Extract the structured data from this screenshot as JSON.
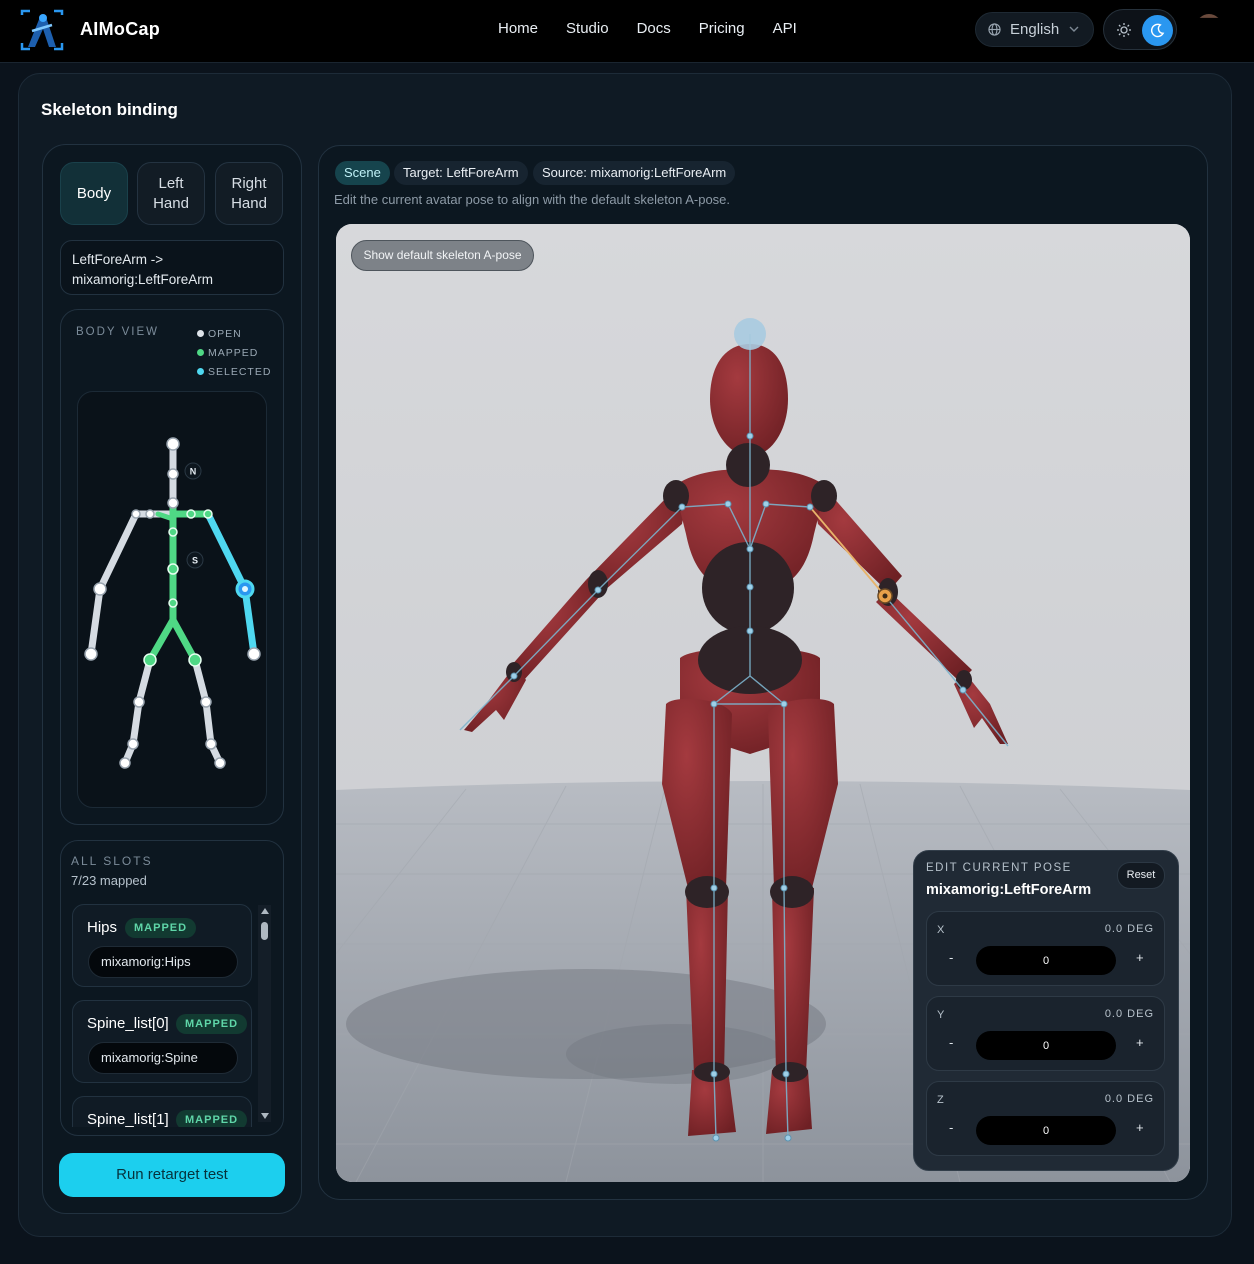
{
  "nav": {
    "brand": "AIMoCap",
    "links": [
      "Home",
      "Studio",
      "Docs",
      "Pricing",
      "API"
    ],
    "language": "English"
  },
  "page": {
    "title": "Skeleton binding"
  },
  "segments": [
    {
      "label": "Body",
      "active": true
    },
    {
      "label": "Left Hand",
      "active": false
    },
    {
      "label": "Right Hand",
      "active": false
    }
  ],
  "mapping": {
    "text": "LeftForeArm -> mixamorig:LeftForeArm"
  },
  "body_view": {
    "title": "BODY VIEW",
    "legend": [
      {
        "label": "OPEN",
        "color": "#dfe4ea"
      },
      {
        "label": "MAPPED",
        "color": "#4fd885"
      },
      {
        "label": "SELECTED",
        "color": "#4fd8f0"
      }
    ],
    "markers": [
      "N",
      "S"
    ]
  },
  "slots": {
    "title": "ALL SLOTS",
    "count": "7/23 mapped",
    "items": [
      {
        "name": "Hips",
        "badge": "MAPPED",
        "value": "mixamorig:Hips"
      },
      {
        "name": "Spine_list[0]",
        "badge": "MAPPED",
        "value": "mixamorig:Spine"
      },
      {
        "name": "Spine_list[1]",
        "badge": "MAPPED",
        "value": ""
      }
    ]
  },
  "run_button": "Run retarget test",
  "chips": {
    "scene": "Scene",
    "target": "Target: LeftForeArm",
    "source": "Source: mixamorig:LeftForeArm"
  },
  "hint": "Edit the current avatar pose to align with the default skeleton A-pose.",
  "viewport": {
    "show_button": "Show default skeleton A-pose"
  },
  "pose": {
    "title": "EDIT CURRENT POSE",
    "bone": "mixamorig:LeftForeArm",
    "reset": "Reset",
    "axes": [
      {
        "name": "X",
        "deg": "0.0 DEG",
        "value": "0"
      },
      {
        "name": "Y",
        "deg": "0.0 DEG",
        "value": "0"
      },
      {
        "name": "Z",
        "deg": "0.0 DEG",
        "value": "0"
      }
    ],
    "minus": "-",
    "plus": "+"
  },
  "colors": {
    "accent": "#1ccfee",
    "mapped": "#4fd885",
    "selected": "#4fd8f0",
    "mannequin": "#8a2a2e"
  }
}
